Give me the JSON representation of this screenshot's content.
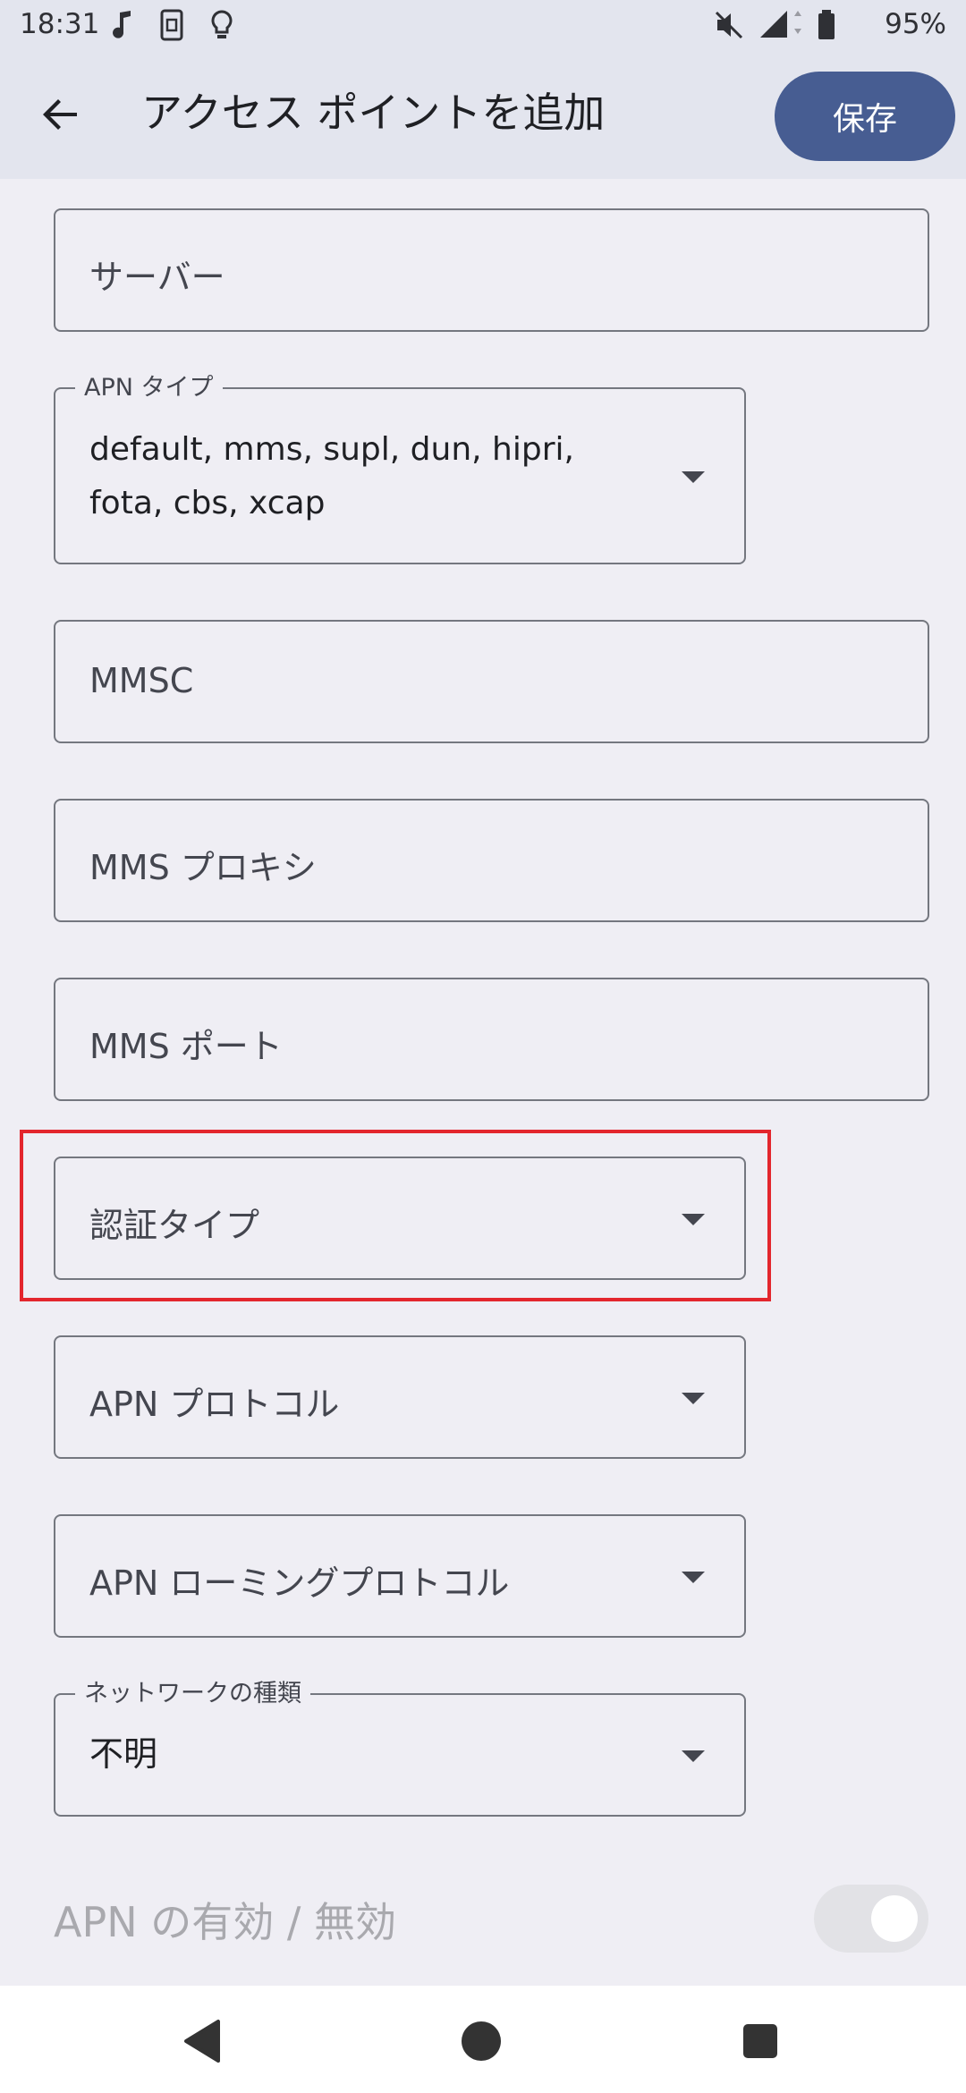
{
  "status_bar": {
    "time": "18:31",
    "battery_percent": "95%",
    "icons": [
      "music-note-icon",
      "nfc-icon",
      "lightbulb-icon",
      "mute-icon",
      "signal-icon",
      "battery-icon"
    ]
  },
  "app_bar": {
    "title": "アクセス ポイントを追加",
    "save_label": "保存"
  },
  "fields": {
    "server": {
      "placeholder": "サーバー"
    },
    "apn_type": {
      "label": "APN タイプ",
      "value_line1": "default, mms, supl, dun, hipri,",
      "value_line2": "fota, cbs, xcap"
    },
    "mmsc": {
      "placeholder": "MMSC"
    },
    "mms_proxy": {
      "placeholder": "MMS プロキシ"
    },
    "mms_port": {
      "placeholder": "MMS ポート"
    },
    "auth_type": {
      "placeholder": "認証タイプ"
    },
    "apn_protocol": {
      "placeholder": "APN プロトコル"
    },
    "apn_roaming_protocol": {
      "placeholder": "APN ローミングプロトコル"
    },
    "network_type": {
      "label": "ネットワークの種類",
      "value": "不明"
    }
  },
  "toggle": {
    "label": "APN の有効 / 無効",
    "enabled": false
  },
  "colors": {
    "accent": "#475d92",
    "highlight": "#e3262d",
    "background": "#efeef4",
    "appbar": "#e3e5ee"
  }
}
